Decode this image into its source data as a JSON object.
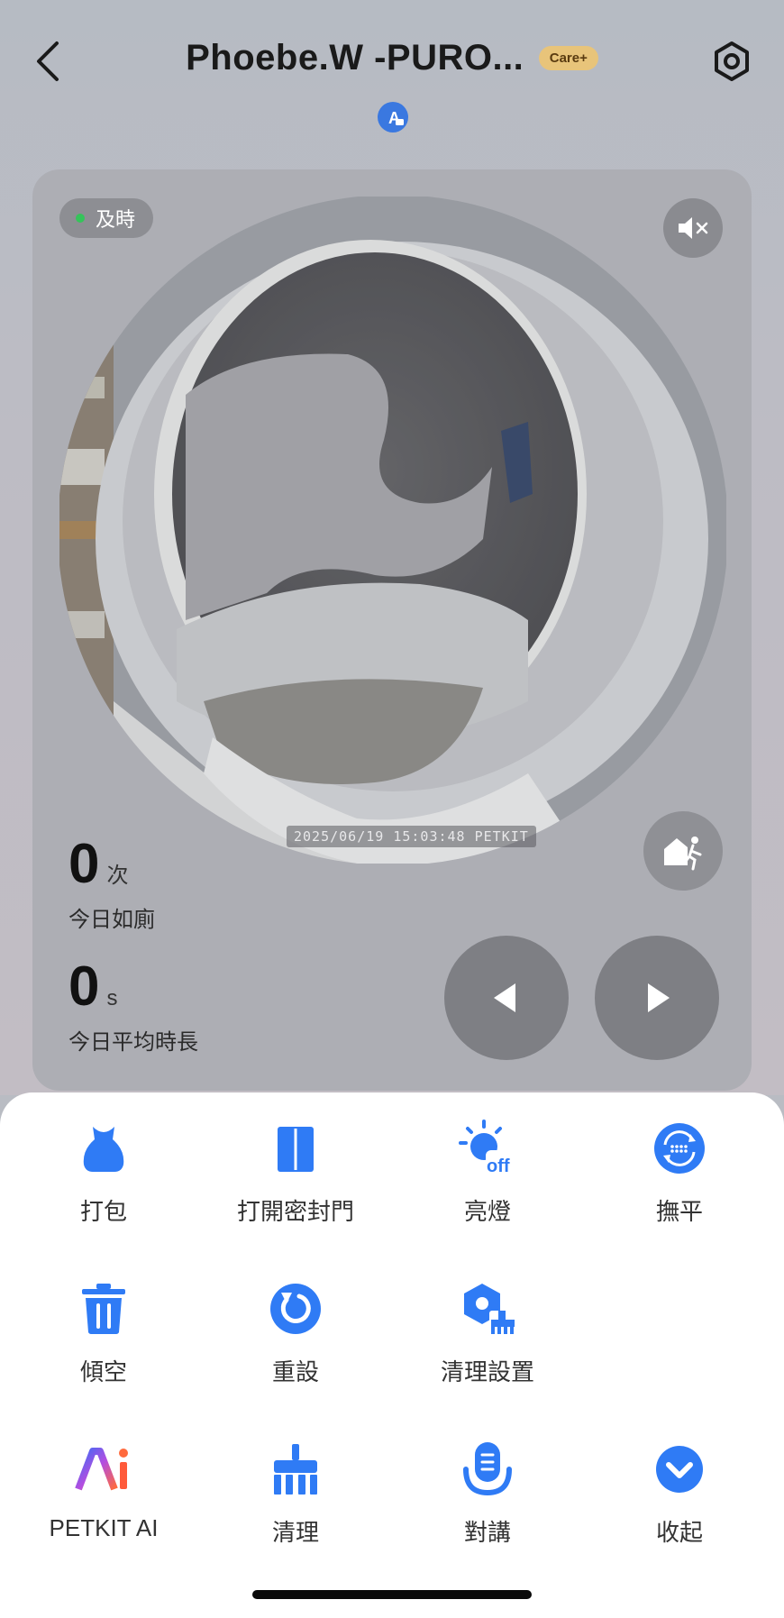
{
  "header": {
    "title": "Phoebe.W -PURO...",
    "badge": "Care+"
  },
  "camera": {
    "live_label": "及時",
    "timestamp": "2025/06/19 15:03:48 PETKIT",
    "stats": [
      {
        "value": "0",
        "unit": "次",
        "label": "今日如廁"
      },
      {
        "value": "0",
        "unit": "s",
        "label": "今日平均時長"
      }
    ]
  },
  "actions": [
    {
      "label": "打包",
      "icon": "bag-icon"
    },
    {
      "label": "打開密封門",
      "icon": "door-icon"
    },
    {
      "label": "亮燈",
      "icon": "light-off-icon"
    },
    {
      "label": "撫平",
      "icon": "smooth-icon"
    },
    {
      "label": "傾空",
      "icon": "trash-icon"
    },
    {
      "label": "重設",
      "icon": "reset-icon"
    },
    {
      "label": "清理設置",
      "icon": "clean-settings-icon"
    },
    {
      "label": "PETKIT AI",
      "icon": "ai-icon"
    },
    {
      "label": "清理",
      "icon": "broom-icon"
    },
    {
      "label": "對講",
      "icon": "intercom-icon"
    },
    {
      "label": "收起",
      "icon": "collapse-icon"
    }
  ],
  "colors": {
    "accent": "#2f7bf5",
    "badge_bg": "#e8c47a",
    "live_dot": "#35c45a"
  }
}
